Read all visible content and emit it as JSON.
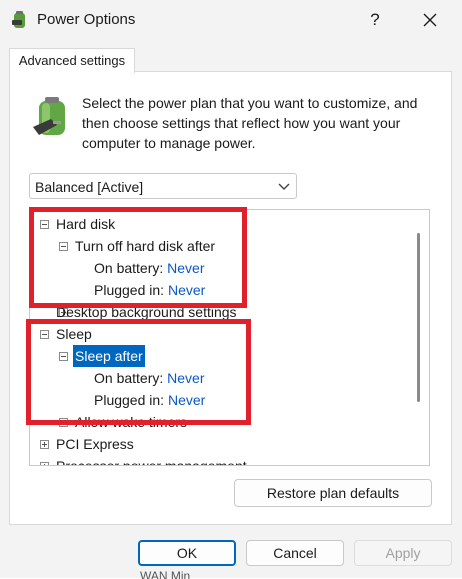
{
  "window": {
    "title": "Power Options",
    "help_symbol": "?",
    "close_symbol": "✕"
  },
  "tab": {
    "label": "Advanced settings"
  },
  "description": "Select the power plan that you want to customize, and then choose settings that reflect how you want your computer to manage power.",
  "plan_select": {
    "value": "Balanced [Active]"
  },
  "tree": {
    "hard_disk": {
      "label": "Hard disk",
      "child": "Turn off hard disk after",
      "on_battery_label": "On battery:",
      "on_battery_value": "Never",
      "plugged_in_label": "Plugged in:",
      "plugged_in_value": "Never"
    },
    "desktop_bg": "Desktop background settings",
    "sleep": {
      "label": "Sleep",
      "child": "Sleep after",
      "on_battery_label": "On battery:",
      "on_battery_value": "Never",
      "plugged_in_label": "Plugged in:",
      "plugged_in_value": "Never"
    },
    "wake_timers": "Allow wake timers",
    "pci_express": "PCI Express",
    "processor": "Processor power management"
  },
  "buttons": {
    "restore": "Restore plan defaults",
    "ok": "OK",
    "cancel": "Cancel",
    "apply": "Apply"
  },
  "annotation_color": "#e0202a",
  "selection_color": "#0067c0",
  "background_peek": "WAN Min"
}
